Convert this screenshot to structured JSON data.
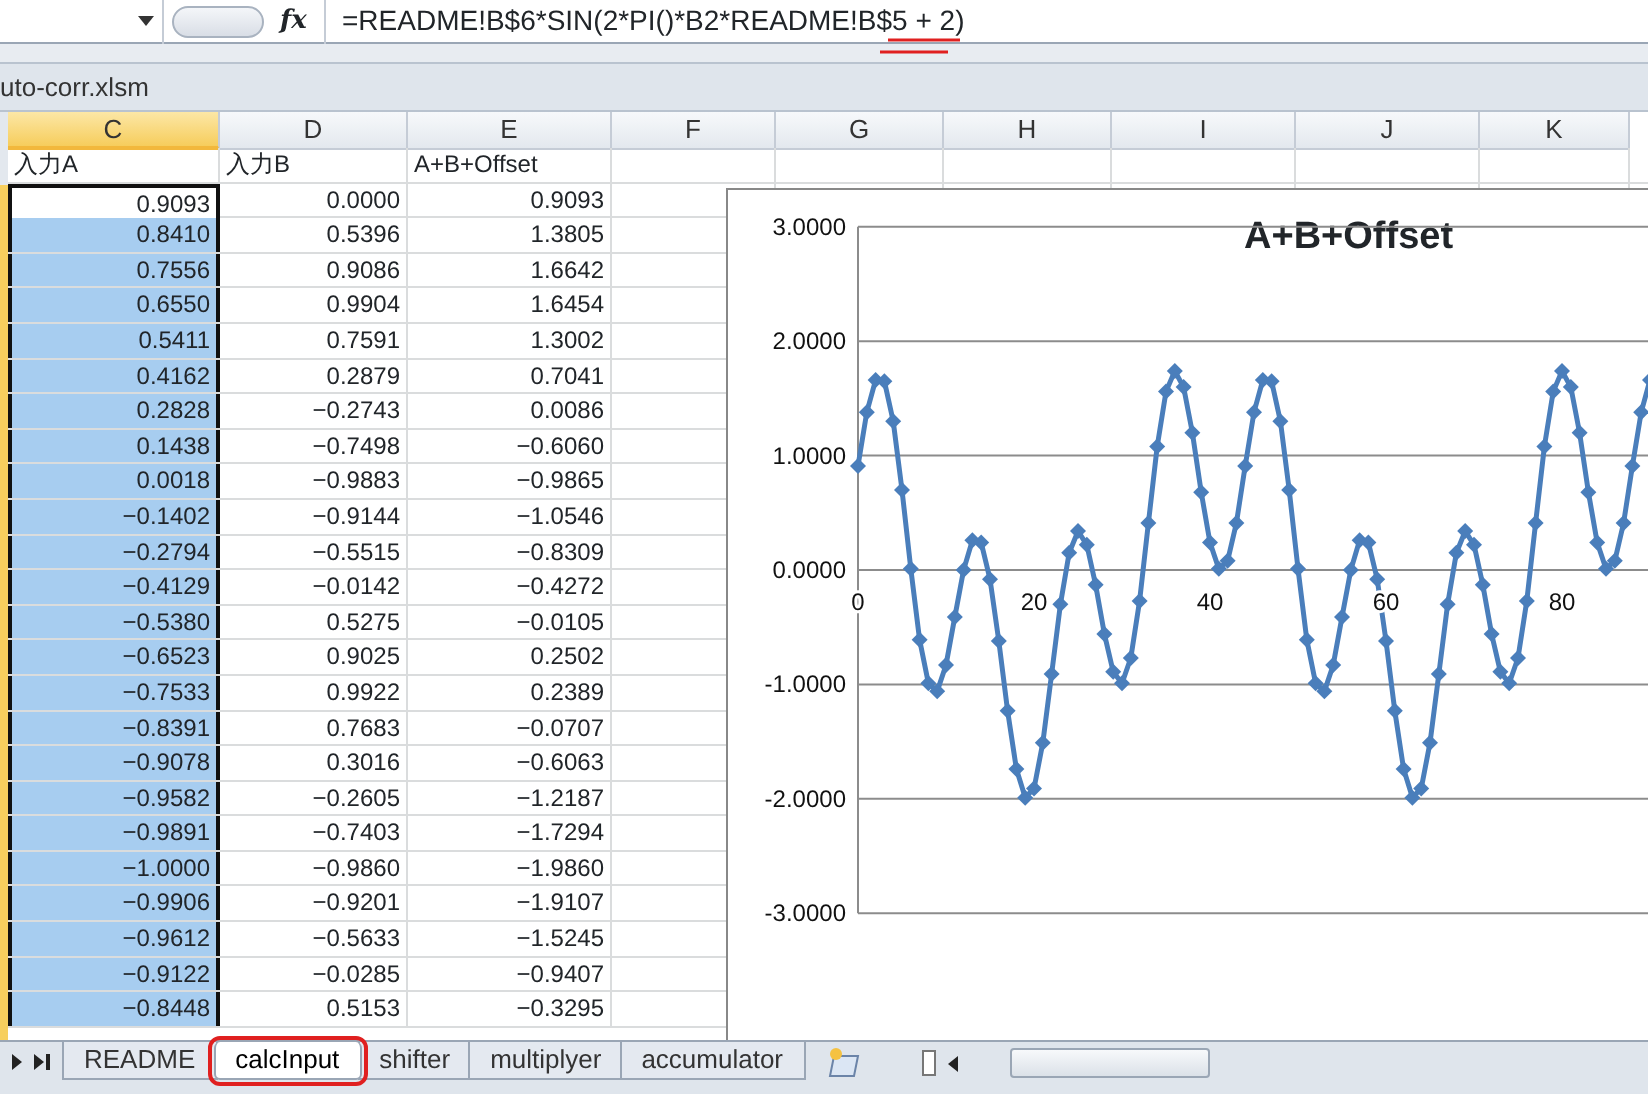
{
  "formula_bar": {
    "function_label": "fx",
    "formula": "=README!B$6*SIN(2*PI()*B2*README!B$5 + 2)",
    "end_underlined": true
  },
  "workbook": {
    "title": "uto-corr.xlsm"
  },
  "columns": [
    {
      "label": "C",
      "selected": true
    },
    {
      "label": "D",
      "selected": false
    },
    {
      "label": "E",
      "selected": false
    },
    {
      "label": "F",
      "selected": false
    },
    {
      "label": "G",
      "selected": false
    },
    {
      "label": "H",
      "selected": false
    },
    {
      "label": "I",
      "selected": false
    },
    {
      "label": "J",
      "selected": false
    },
    {
      "label": "K",
      "selected": false
    }
  ],
  "rows": [
    {
      "cells": [
        "入力A",
        "入力B",
        "A+B+Offset"
      ],
      "selected": false,
      "active": false
    },
    {
      "cells": [
        "0.9093",
        "0.0000",
        "0.9093"
      ],
      "selected": true,
      "active": true
    },
    {
      "cells": [
        "0.8410",
        "0.5396",
        "1.3805"
      ],
      "selected": true,
      "active": false
    },
    {
      "cells": [
        "0.7556",
        "0.9086",
        "1.6642"
      ],
      "selected": true,
      "active": false
    },
    {
      "cells": [
        "0.6550",
        "0.9904",
        "1.6454"
      ],
      "selected": true,
      "active": false
    },
    {
      "cells": [
        "0.5411",
        "0.7591",
        "1.3002"
      ],
      "selected": true,
      "active": false
    },
    {
      "cells": [
        "0.4162",
        "0.2879",
        "0.7041"
      ],
      "selected": true,
      "active": false
    },
    {
      "cells": [
        "0.2828",
        "−0.2743",
        "0.0086"
      ],
      "selected": true,
      "active": false
    },
    {
      "cells": [
        "0.1438",
        "−0.7498",
        "−0.6060"
      ],
      "selected": true,
      "active": false
    },
    {
      "cells": [
        "0.0018",
        "−0.9883",
        "−0.9865"
      ],
      "selected": true,
      "active": false
    },
    {
      "cells": [
        "−0.1402",
        "−0.9144",
        "−1.0546"
      ],
      "selected": true,
      "active": false
    },
    {
      "cells": [
        "−0.2794",
        "−0.5515",
        "−0.8309"
      ],
      "selected": true,
      "active": false
    },
    {
      "cells": [
        "−0.4129",
        "−0.0142",
        "−0.4272"
      ],
      "selected": true,
      "active": false
    },
    {
      "cells": [
        "−0.5380",
        "0.5275",
        "−0.0105"
      ],
      "selected": true,
      "active": false
    },
    {
      "cells": [
        "−0.6523",
        "0.9025",
        "0.2502"
      ],
      "selected": true,
      "active": false
    },
    {
      "cells": [
        "−0.7533",
        "0.9922",
        "0.2389"
      ],
      "selected": true,
      "active": false
    },
    {
      "cells": [
        "−0.8391",
        "0.7683",
        "−0.0707"
      ],
      "selected": true,
      "active": false
    },
    {
      "cells": [
        "−0.9078",
        "0.3016",
        "−0.6063"
      ],
      "selected": true,
      "active": false
    },
    {
      "cells": [
        "−0.9582",
        "−0.2605",
        "−1.2187"
      ],
      "selected": true,
      "active": false
    },
    {
      "cells": [
        "−0.9891",
        "−0.7403",
        "−1.7294"
      ],
      "selected": true,
      "active": false
    },
    {
      "cells": [
        "−1.0000",
        "−0.9860",
        "−1.9860"
      ],
      "selected": true,
      "active": false
    },
    {
      "cells": [
        "−0.9906",
        "−0.9201",
        "−1.9107"
      ],
      "selected": true,
      "active": false
    },
    {
      "cells": [
        "−0.9612",
        "−0.5633",
        "−1.5245"
      ],
      "selected": true,
      "active": false
    },
    {
      "cells": [
        "−0.9122",
        "−0.0285",
        "−0.9407"
      ],
      "selected": true,
      "active": false
    },
    {
      "cells": [
        "−0.8448",
        "0.5153",
        "−0.3295"
      ],
      "selected": true,
      "active": false
    }
  ],
  "chart": {
    "chart_data": {
      "type": "line",
      "title": "A+B+Offset",
      "grid": true,
      "xlim": [
        0,
        90
      ],
      "ylim": [
        -3,
        3
      ],
      "xticks": [
        0,
        20,
        40,
        60,
        80
      ],
      "yticks": [
        {
          "value": 3,
          "label": "3.0000"
        },
        {
          "value": 2,
          "label": "2.0000"
        },
        {
          "value": 1,
          "label": "1.0000"
        },
        {
          "value": 0,
          "label": "0.0000"
        },
        {
          "value": -1,
          "label": "-1.0000"
        },
        {
          "value": -2,
          "label": "-2.0000"
        },
        {
          "value": -3,
          "label": "-3.0000"
        }
      ],
      "x": [
        0,
        1,
        2,
        3,
        4,
        5,
        6,
        7,
        8,
        9,
        10,
        11,
        12,
        13,
        14,
        15,
        16,
        17,
        18,
        19,
        20,
        21,
        22,
        23,
        24,
        25,
        26,
        27,
        28,
        29,
        30,
        31,
        32,
        33,
        34,
        35,
        36,
        37,
        38,
        39,
        40,
        41,
        42,
        43,
        44,
        45,
        46,
        47,
        48,
        49,
        50,
        51,
        52,
        53,
        54,
        55,
        56,
        57,
        58,
        59,
        60,
        61,
        62,
        63,
        64,
        65,
        66,
        67,
        68,
        69,
        70,
        71,
        72,
        73,
        74,
        75,
        76,
        77,
        78,
        79,
        80,
        81,
        82,
        83,
        84,
        85,
        86,
        87,
        88,
        89,
        90
      ],
      "series": [
        {
          "color": "#4a7ebb",
          "marker": "diamond",
          "values": [
            0.91,
            1.38,
            1.66,
            1.65,
            1.3,
            0.7,
            0.01,
            -0.61,
            -0.99,
            -1.06,
            -0.83,
            -0.41,
            0,
            0.26,
            0.24,
            -0.08,
            -0.62,
            -1.23,
            -1.74,
            -1.99,
            -1.91,
            -1.51,
            -0.91,
            -0.3,
            0.15,
            0.34,
            0.22,
            -0.13,
            -0.56,
            -0.89,
            -0.99,
            -0.77,
            -0.27,
            0.41,
            1.08,
            1.56,
            1.74,
            1.6,
            1.2,
            0.68,
            0.24,
            0.01,
            0.08,
            0.41,
            0.91,
            1.38,
            1.66,
            1.65,
            1.3,
            0.7,
            0.01,
            -0.61,
            -0.99,
            -1.06,
            -0.83,
            -0.41,
            0,
            0.26,
            0.24,
            -0.08,
            -0.62,
            -1.23,
            -1.74,
            -1.99,
            -1.91,
            -1.51,
            -0.91,
            -0.3,
            0.15,
            0.34,
            0.22,
            -0.13,
            -0.56,
            -0.89,
            -0.99,
            -0.77,
            -0.27,
            0.41,
            1.08,
            1.56,
            1.74,
            1.6,
            1.2,
            0.68,
            0.24,
            0.01,
            0.08,
            0.41,
            0.91,
            1.38,
            1.66
          ]
        }
      ]
    }
  },
  "sheet_tabs": [
    {
      "label": "README",
      "selected": false,
      "annotated": false
    },
    {
      "label": "calcInput",
      "selected": true,
      "annotated": true
    },
    {
      "label": "shifter",
      "selected": false,
      "annotated": false
    },
    {
      "label": "multiplyer",
      "selected": false,
      "annotated": false
    },
    {
      "label": "accumulator",
      "selected": false,
      "annotated": false
    }
  ]
}
